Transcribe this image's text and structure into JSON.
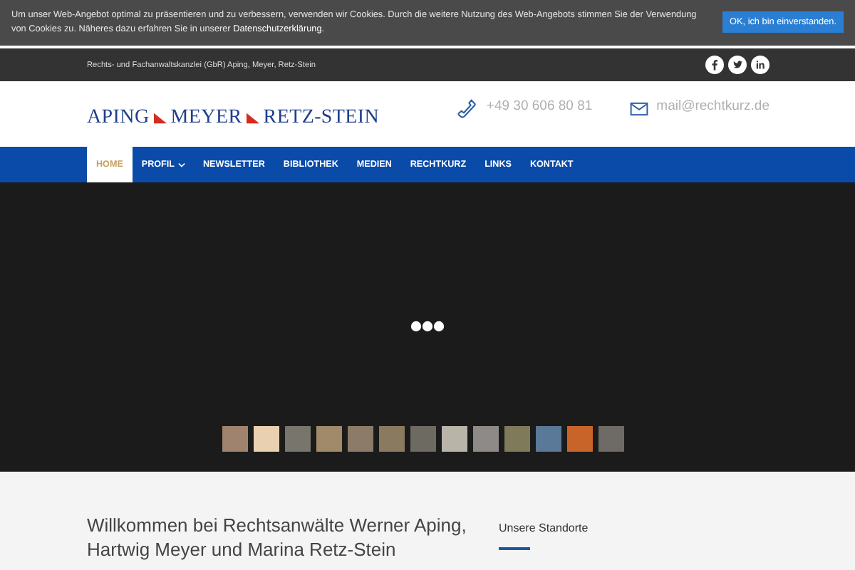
{
  "cookie_notice": {
    "text": "Um unser Web-Angebot optimal zu präsentieren und zu verbessern, verwenden wir Cookies. Durch die weitere Nutzung des Web-Angebots stimmen Sie der Verwendung von Cookies zu. Näheres dazu erfahren Sie in unserer ",
    "link": "Datenschutzerklärung",
    "after": ".",
    "button": "OK, ich bin einverstanden."
  },
  "top_bar": {
    "text": "Rechts- und Fachanwaltskanzlei (GbR) Aping, Meyer, Retz-Stein",
    "social": [
      {
        "kind": "facebook"
      },
      {
        "kind": "twitter"
      },
      {
        "kind": "linkedin"
      }
    ]
  },
  "header": {
    "logo": [
      "APING",
      "MEYER",
      "RETZ-STEIN"
    ],
    "phone": "+49 30 606 80 81",
    "email": "mail@rechtkurz.de"
  },
  "nav": [
    {
      "label": "HOME",
      "selected": true,
      "has_dropdown": false
    },
    {
      "label": "PROFIL",
      "selected": false,
      "has_dropdown": true
    },
    {
      "label": "NEWSLETTER",
      "selected": false,
      "has_dropdown": false
    },
    {
      "label": "BIBLIOTHEK",
      "selected": false,
      "has_dropdown": false
    },
    {
      "label": "MEDIEN",
      "selected": false,
      "has_dropdown": false
    },
    {
      "label": "RECHTKURZ",
      "selected": false,
      "has_dropdown": false
    },
    {
      "label": "LINKS",
      "selected": false,
      "has_dropdown": false
    },
    {
      "label": "KONTAKT",
      "selected": false,
      "has_dropdown": false
    }
  ],
  "content": {
    "heading": "Willkommen bei Rechtsanwälte Werner Aping, Hartwig Meyer und Marina Retz-Stein",
    "sidebar_heading": "Unsere Standorte"
  }
}
